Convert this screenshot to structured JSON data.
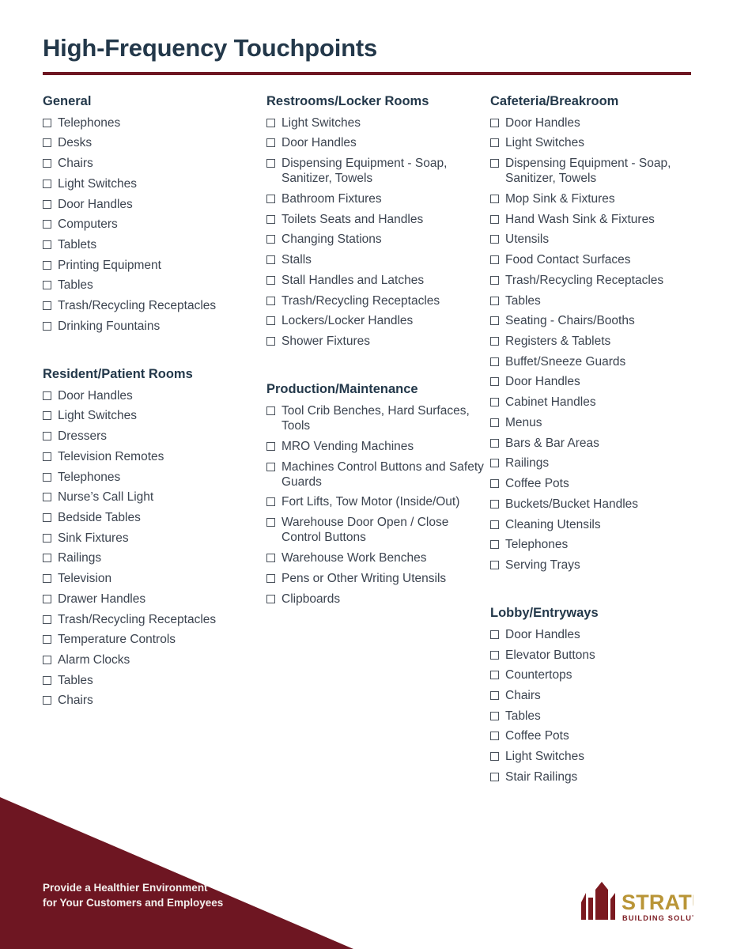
{
  "document": {
    "title": "High-Frequency Touchpoints"
  },
  "columns": [
    {
      "id": "column-1",
      "sections": [
        {
          "heading": "General",
          "items": [
            "Telephones",
            "Desks",
            "Chairs",
            "Light Switches",
            "Door Handles",
            "Computers",
            "Tablets",
            "Printing Equipment",
            "Tables",
            "Trash/Recycling Receptacles",
            "Drinking Fountains"
          ]
        },
        {
          "heading": "Resident/Patient Rooms",
          "items": [
            "Door Handles",
            "Light Switches",
            "Dressers",
            "Television Remotes",
            "Telephones",
            "Nurse’s Call Light",
            "Bedside Tables",
            "Sink Fixtures",
            "Railings",
            "Television",
            "Drawer Handles",
            "Trash/Recycling Receptacles",
            "Temperature Controls",
            "Alarm Clocks",
            "Tables",
            "Chairs"
          ]
        }
      ]
    },
    {
      "id": "column-2",
      "sections": [
        {
          "heading": "Restrooms/Locker Rooms",
          "items": [
            "Light Switches",
            "Door Handles",
            "Dispensing Equipment - Soap, Sanitizer, Towels",
            "Bathroom Fixtures",
            "Toilets Seats and Handles",
            "Changing Stations",
            "Stalls",
            "Stall Handles and Latches",
            "Trash/Recycling Receptacles",
            "Lockers/Locker Handles",
            "Shower Fixtures"
          ]
        },
        {
          "heading": "Production/Maintenance",
          "items": [
            "Tool Crib Benches, Hard Surfaces, Tools",
            "MRO Vending Machines",
            "Machines Control Buttons and Safety Guards",
            "Fort Lifts, Tow Motor (Inside/Out)",
            "Warehouse Door Open / Close Control Buttons",
            "Warehouse Work Benches",
            "Pens or Other Writing Utensils",
            "Clipboards"
          ]
        }
      ]
    },
    {
      "id": "column-3",
      "sections": [
        {
          "heading": "Cafeteria/Breakroom",
          "items": [
            "Door Handles",
            "Light Switches",
            "Dispensing Equipment - Soap, Sanitizer, Towels",
            "Mop Sink & Fixtures",
            "Hand Wash Sink & Fixtures",
            "Utensils",
            "Food Contact Surfaces",
            "Trash/Recycling Receptacles",
            "Tables",
            "Seating - Chairs/Booths",
            "Registers & Tablets",
            "Buffet/Sneeze Guards",
            "Door Handles",
            "Cabinet Handles",
            "Menus",
            "Bars & Bar Areas",
            "Railings",
            "Coffee Pots",
            "Buckets/Bucket Handles",
            "Cleaning Utensils",
            "Telephones",
            "Serving Trays"
          ]
        },
        {
          "heading": "Lobby/Entryways",
          "items": [
            "Door Handles",
            "Elevator Buttons",
            "Countertops",
            "Chairs",
            "Tables",
            "Coffee Pots",
            "Light Switches",
            "Stair Railings"
          ]
        }
      ]
    }
  ],
  "footer": {
    "tagline": "Provide a Healthier Environment for Your Customers and Employees",
    "logo": {
      "wordmark": "STRATUS",
      "subtext": "BUILDING SOLUTIONS"
    }
  },
  "colors": {
    "brand_red": "#6e1622",
    "title_navy": "#23384a",
    "body_text": "#3c4450",
    "logo_gold": "#b99537",
    "footer_text": "#f2eeec"
  }
}
